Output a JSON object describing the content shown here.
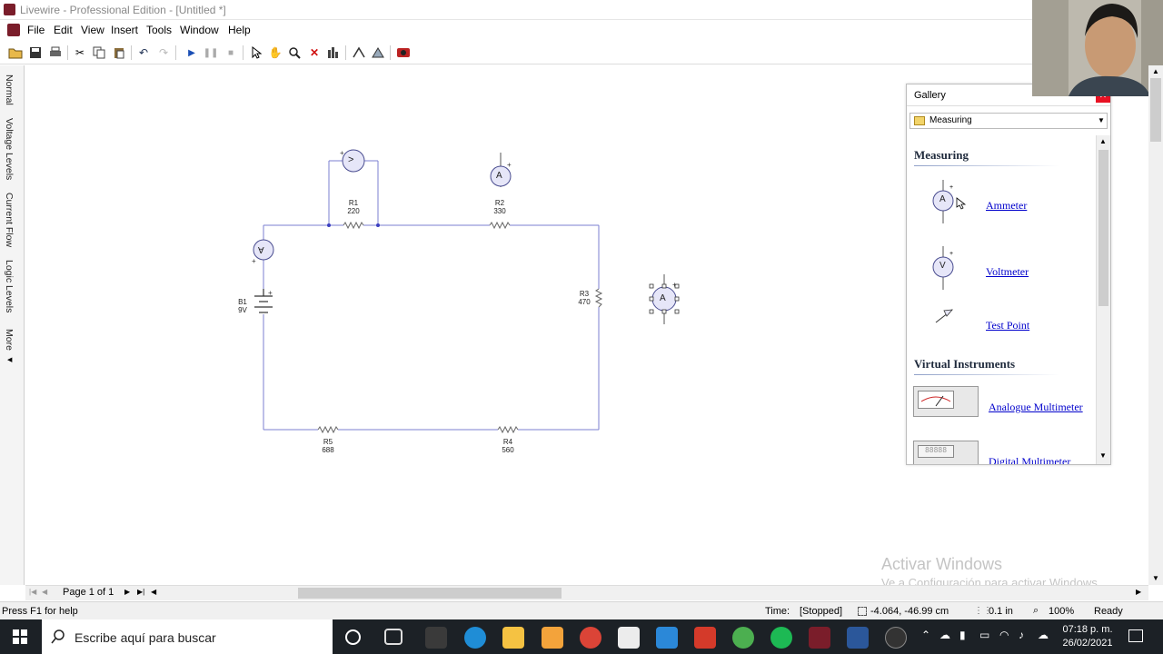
{
  "window": {
    "title": "Livewire - Professional Edition - [Untitled *]"
  },
  "menu": [
    "File",
    "Edit",
    "View",
    "Insert",
    "Tools",
    "Window",
    "Help"
  ],
  "left_tabs": [
    "Normal",
    "Voltage Levels",
    "Current Flow",
    "Logic Levels",
    "More"
  ],
  "circuit": {
    "R1": {
      "name": "R1",
      "value": "220"
    },
    "R2": {
      "name": "R2",
      "value": "330"
    },
    "R3": {
      "name": "R3",
      "value": "470"
    },
    "R4": {
      "name": "R4",
      "value": "560"
    },
    "R5": {
      "name": "R5",
      "value": "688"
    },
    "B1": {
      "name": "B1",
      "value": "9V"
    },
    "voltmeter_glyph": ">",
    "ammeter_glyph": "A"
  },
  "gallery": {
    "title": "Gallery",
    "category": "Measuring",
    "section1": "Measuring",
    "items": [
      "Ammeter",
      "Voltmeter",
      "Test Point"
    ],
    "section2": "Virtual Instruments",
    "instruments": [
      "Analogue Multimeter",
      "Digital Multimeter"
    ],
    "meter_a": "A",
    "meter_v": "V",
    "digital_display": "88888"
  },
  "page_nav": {
    "label": "Page 1 of 1"
  },
  "watermark": {
    "line1": "Activar Windows",
    "line2": "Ve a Configuración para activar Windows."
  },
  "status": {
    "help": "Press F1 for help",
    "time_label": "Time:",
    "time_value": "[Stopped]",
    "coords": "-4.064, -46.99 cm",
    "grid": "0.1 in",
    "zoom": "100%",
    "state": "Ready"
  },
  "taskbar": {
    "search_placeholder": "Escribe aquí para buscar",
    "time": "07:18 p. m.",
    "date": "26/02/2021"
  },
  "colors": {
    "wire": "#7b7fd0",
    "meter_fill": "#e6e6f8",
    "accent_red": "#e81123"
  }
}
